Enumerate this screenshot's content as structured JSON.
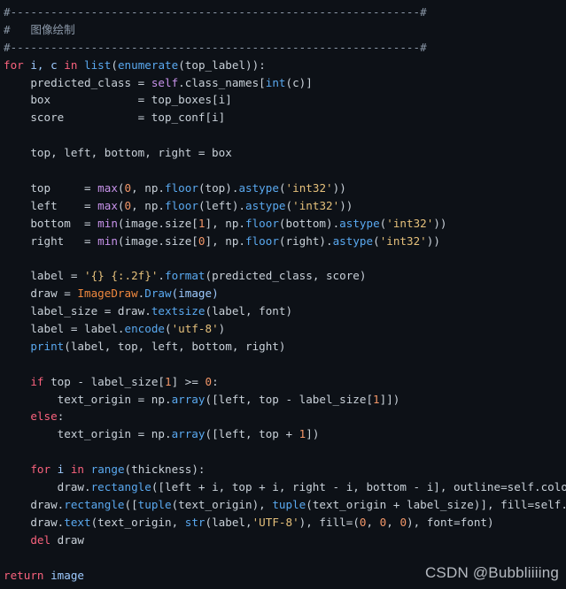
{
  "editor": {
    "background_color": "#0d1117",
    "default_text_color": "#c9d1d9",
    "language": "python",
    "font_size_px": 12.6,
    "line_height_px": 19.9
  },
  "palette": {
    "comment": "#8b98a8",
    "keyword": "#f9627d",
    "builtin_magenta": "#c792ea",
    "function_blue": "#5aa9f0",
    "variable_blue": "#9ecbff",
    "string": "#e5c07b",
    "number": "#f29668",
    "class_name": "#f0883e",
    "operator": "#89b4e8",
    "plain": "#c9d1d9"
  },
  "code": {
    "separator_rule": "#-------------------------------------------------------------#",
    "comment_hash": "#",
    "comment_title": "图像绘制",
    "lines": {
      "l4_kw_for": "for",
      "l4_i_c": " i, c ",
      "l4_kw_in": "in",
      "l4_sp": " ",
      "l4_list": "list",
      "l4_open": "(",
      "l4_enumerate": "enumerate",
      "l4_open2": "(",
      "l4_toplabel": "top_label",
      "l4_close": ")):",
      "l5_indent": "    ",
      "l5_predicted": "predicted_class = ",
      "l5_self": "self",
      "l5_dot_classnames": ".class_names[",
      "l5_int": "int",
      "l5_c": "(c)]",
      "l6_box": "    box             = top_boxes[i]",
      "l7_score": "    score           = top_conf[i]",
      "l9_unpack": "    top, left, bottom, right = box",
      "l11_lhs": "    top     = ",
      "l11_max": "max",
      "l11_open": "(",
      "l11_zero": "0",
      "l11_mid": ", np.",
      "l11_floor": "floor",
      "l11_arg": "(top).",
      "l11_astype": "astype",
      "l11_o2": "(",
      "l11_str": "'int32'",
      "l11_close": "))",
      "l12_lhs": "    left    = ",
      "l12_arg": "(left).",
      "l13_lhs": "    bottom  = ",
      "l13_min": "min",
      "l13_mid1": "(image.size[",
      "l13_one": "1",
      "l13_mid2": "], np.",
      "l13_arg": "(bottom).",
      "l14_lhs": "    right   = ",
      "l14_mid1": "(image.size[",
      "l14_zero": "0",
      "l14_arg": "(right).",
      "l16_pre": "    label = ",
      "l16_str": "'{} {:.2f}'",
      "l16_dot": ".",
      "l16_format": "format",
      "l16_args": "(predicted_class, score)",
      "l17_pre": "    draw = ",
      "l17_cls": "ImageDraw",
      "l17_dot": ".",
      "l17_draw": "Draw",
      "l17_args": "(image)",
      "l18_pre": "    label_size = draw.",
      "l18_textsize": "textsize",
      "l18_args": "(label, font)",
      "l19_pre": "    label = label.",
      "l19_encode": "encode",
      "l19_o": "(",
      "l19_str": "'utf-8'",
      "l19_c": ")",
      "l20_print": "print",
      "l20_args": "(label, top, left, bottom, right)",
      "l22_if": "if",
      "l22_cond": " top - label_size[",
      "l22_one": "1",
      "l22_mid": "] >= ",
      "l22_zero": "0",
      "l22_colon": ":",
      "l23_pre": "        text_origin = np.",
      "l23_array": "array",
      "l23_a1": "([left, top - label_size[",
      "l23_one": "1",
      "l23_a2": "]])",
      "l24_else": "else",
      "l24_colon": ":",
      "l25_pre": "        text_origin = np.",
      "l25_a1": "([left, top + ",
      "l25_one": "1",
      "l25_a2": "])",
      "l27_for": "for",
      "l27_i": " i ",
      "l27_in": "in",
      "l27_sp": " ",
      "l27_range": "range",
      "l27_args": "(thickness):",
      "l28_pre": "        draw.",
      "l28_rect": "rectangle",
      "l28_args": "([left + i, top + i, right - i, bottom - i], outline=self.colors[c])",
      "l29_pre": "    draw.",
      "l29_rect": "rectangle",
      "l29_a1": "([",
      "l29_tuple1": "tuple",
      "l29_a2": "(text_origin), ",
      "l29_tuple2": "tuple",
      "l29_a3": "(text_origin + label_size)], fill=self.colors[c])",
      "l30_pre": "    draw.",
      "l30_text": "text",
      "l30_a1": "(text_origin, ",
      "l30_str_fn": "str",
      "l30_a2": "(label,",
      "l30_utf": "'UTF-8'",
      "l30_a3": "), fill=(",
      "l30_z1": "0",
      "l30_c1": ", ",
      "l30_z2": "0",
      "l30_c2": ", ",
      "l30_z3": "0",
      "l30_a4": "), font=font)",
      "l31_del": "del",
      "l31_draw": " draw",
      "l33_return": "return",
      "l33_image": " image"
    }
  },
  "watermark": {
    "text": "CSDN @Bubbliiiing"
  }
}
